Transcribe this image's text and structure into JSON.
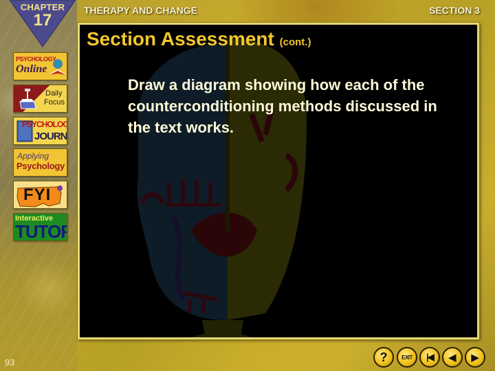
{
  "header": {
    "chapter_label": "CHAPTER",
    "chapter_number": "17",
    "title": "THERAPY AND CHANGE",
    "section": "SECTION 3"
  },
  "sidebar": {
    "items": [
      {
        "name": "psychology-online",
        "line1": "PSYCHOLOGY",
        "line2": "Online"
      },
      {
        "name": "daily-focus",
        "line1": "Daily",
        "line2": "Focus"
      },
      {
        "name": "psychology-journal",
        "line1": "PSYCHOLOGY",
        "line2": "JOURNAL"
      },
      {
        "name": "applying-psychology",
        "line1": "Applying",
        "line2": "Psychology"
      },
      {
        "name": "fyi",
        "line1": "FYI"
      },
      {
        "name": "interactive-tutor",
        "line1": "Interactive",
        "line2": "TUTOR"
      }
    ]
  },
  "main": {
    "title": "Section Assessment",
    "title_suffix": "(cont.)",
    "prompt": "Draw a diagram showing how each of the counterconditioning methods discussed in the text works."
  },
  "footer": {
    "page_number": "93",
    "nav": [
      {
        "name": "help",
        "glyph": "?"
      },
      {
        "name": "exit",
        "glyph": "EXIT"
      },
      {
        "name": "first",
        "glyph": "|◀"
      },
      {
        "name": "previous",
        "glyph": "◀"
      },
      {
        "name": "next",
        "glyph": "▶"
      }
    ]
  },
  "colors": {
    "title_yellow": "#f3c62a",
    "panel_border": "#e6d870",
    "chapter_purple": "#4c4a8c",
    "gold_background": "#c0a52a"
  }
}
